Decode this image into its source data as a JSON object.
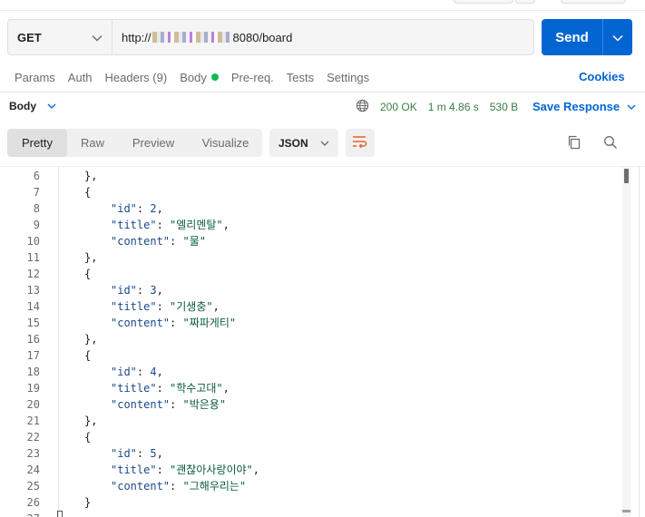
{
  "request": {
    "method": "GET",
    "url_prefix": "http://",
    "url_suffix": "8080/board",
    "send_label": "Send"
  },
  "request_tabs": [
    {
      "label": "Params"
    },
    {
      "label": "Auth"
    },
    {
      "label": "Headers (9)"
    },
    {
      "label": "Body",
      "indicator": "green-dot"
    },
    {
      "label": "Pre-req."
    },
    {
      "label": "Tests"
    },
    {
      "label": "Settings"
    }
  ],
  "cookies_label": "Cookies",
  "response": {
    "section_label": "Body",
    "status": "200 OK",
    "time": "1 m 4.86 s",
    "size": "530 B",
    "save_label": "Save Response",
    "view_tabs": [
      "Pretty",
      "Raw",
      "Preview",
      "Visualize"
    ],
    "active_view": "Pretty",
    "format": "JSON"
  },
  "icons": {
    "method_dropdown": "chevron-down-icon",
    "send_dropdown": "chevron-down-icon",
    "globe": "globe-icon",
    "wrap": "wrap-lines-icon",
    "copy": "copy-icon",
    "search": "search-icon"
  },
  "colors": {
    "accent": "#0265d2",
    "status_green": "#3a7d44",
    "dot_green": "#0cbb52"
  },
  "code_lines": [
    {
      "n": "6",
      "text": "},"
    },
    {
      "n": "7",
      "text": "{"
    },
    {
      "n": "8",
      "key": "\"id\"",
      "sep": ": ",
      "value": "2",
      "end": ","
    },
    {
      "n": "9",
      "key": "\"title\"",
      "sep": ": ",
      "value": "\"엘리멘탈\"",
      "end": ","
    },
    {
      "n": "10",
      "key": "\"content\"",
      "sep": ": ",
      "value": "\"물\"",
      "end": ""
    },
    {
      "n": "11",
      "text": "},"
    },
    {
      "n": "12",
      "text": "{"
    },
    {
      "n": "13",
      "key": "\"id\"",
      "sep": ": ",
      "value": "3",
      "end": ","
    },
    {
      "n": "14",
      "key": "\"title\"",
      "sep": ": ",
      "value": "\"기생충\"",
      "end": ","
    },
    {
      "n": "15",
      "key": "\"content\"",
      "sep": ": ",
      "value": "\"짜파게티\"",
      "end": ""
    },
    {
      "n": "16",
      "text": "},"
    },
    {
      "n": "17",
      "text": "{"
    },
    {
      "n": "18",
      "key": "\"id\"",
      "sep": ": ",
      "value": "4",
      "end": ","
    },
    {
      "n": "19",
      "key": "\"title\"",
      "sep": ": ",
      "value": "\"학수고대\"",
      "end": ","
    },
    {
      "n": "20",
      "key": "\"content\"",
      "sep": ": ",
      "value": "\"박은용\"",
      "end": ""
    },
    {
      "n": "21",
      "text": "},"
    },
    {
      "n": "22",
      "text": "{"
    },
    {
      "n": "23",
      "key": "\"id\"",
      "sep": ": ",
      "value": "5",
      "end": ","
    },
    {
      "n": "24",
      "key": "\"title\"",
      "sep": ": ",
      "value": "\"괜찮아사랑이야\"",
      "end": ","
    },
    {
      "n": "25",
      "key": "\"content\"",
      "sep": ": ",
      "value": "\"그해우리는\"",
      "end": ""
    },
    {
      "n": "26",
      "text": "}"
    },
    {
      "n": "27",
      "text": ""
    }
  ]
}
